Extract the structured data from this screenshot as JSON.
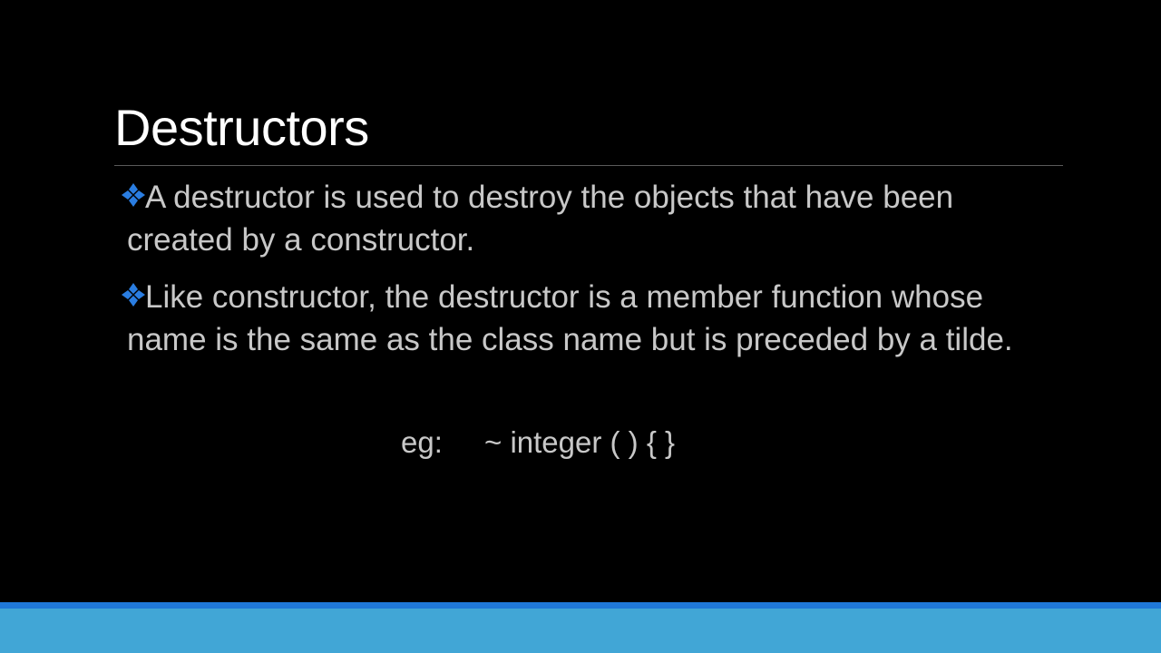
{
  "slide": {
    "title": "Destructors",
    "bullets": [
      {
        "icon": "diamond-bullet-icon",
        "text": "A destructor is used to destroy the objects that have been created by a constructor."
      },
      {
        "icon": "diamond-bullet-icon",
        "text": "Like constructor, the destructor is a member function whose name is the same as the class name but is preceded by a tilde."
      }
    ],
    "example": {
      "label": "eg:",
      "code": "~ integer ( ) { }"
    }
  },
  "colors": {
    "background": "#000000",
    "title": "#ffffff",
    "body_text": "#c8c8c8",
    "bullet_icon": "#2a7de1",
    "footer_line": "#1f78d8",
    "footer_band": "#41a6d6"
  }
}
